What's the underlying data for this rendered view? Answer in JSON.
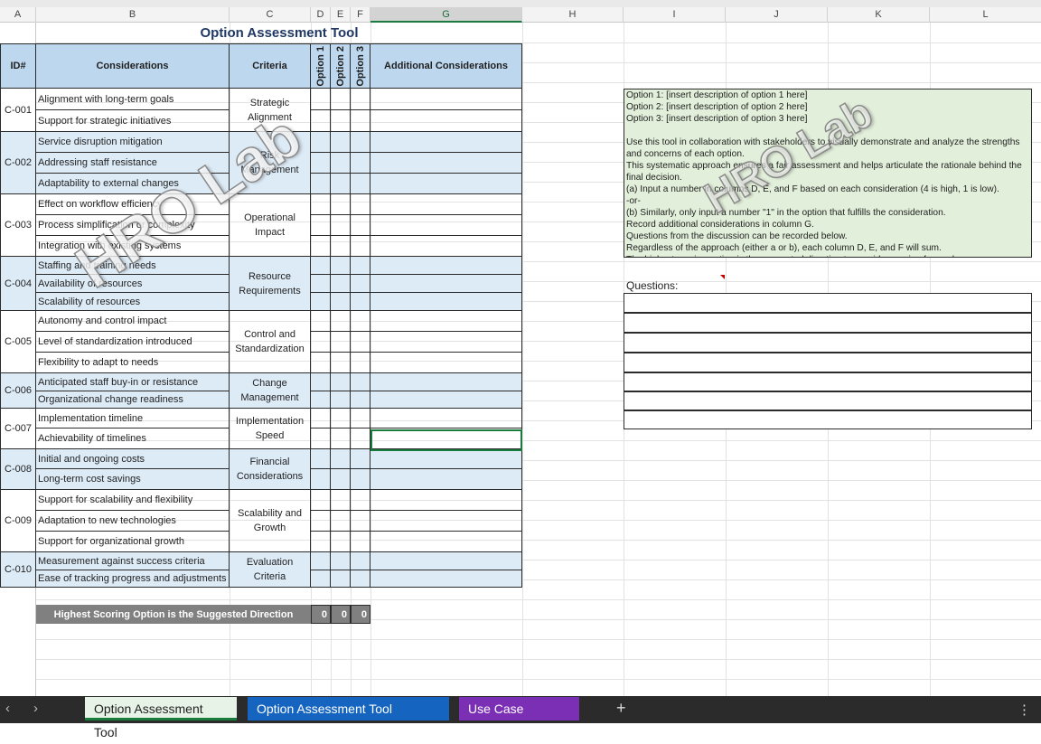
{
  "columns": [
    "A",
    "B",
    "C",
    "D",
    "E",
    "F",
    "G",
    "H",
    "I",
    "J",
    "K",
    "L"
  ],
  "title": "Option Assessment Tool",
  "table_header": {
    "id": "ID#",
    "considerations": "Considerations",
    "criteria": "Criteria",
    "option1": "Option 1",
    "option2": "Option 2",
    "option3": "Option 3",
    "additional": "Additional Considerations"
  },
  "groups": [
    {
      "id": "C-001",
      "criteria": "Strategic Alignment",
      "items": [
        "Alignment with long-term goals",
        "Support for strategic initiatives"
      ]
    },
    {
      "id": "C-002",
      "criteria": "Risk Management",
      "items": [
        "Service disruption mitigation",
        "Addressing staff resistance",
        "Adaptability to external changes"
      ]
    },
    {
      "id": "C-003",
      "criteria": "Operational Impact",
      "items": [
        "Effect on workflow efficiency",
        "Process simplification or complexity",
        "Integration with existing systems"
      ]
    },
    {
      "id": "C-004",
      "criteria": "Resource Requirements",
      "items": [
        "Staffing and training needs",
        "Availability of resources",
        "Scalability of resources"
      ]
    },
    {
      "id": "C-005",
      "criteria": "Control and Standardization",
      "items": [
        "Autonomy and control impact",
        "Level of standardization introduced",
        "Flexibility to adapt to needs"
      ]
    },
    {
      "id": "C-006",
      "criteria": "Change Management",
      "items": [
        "Anticipated staff buy-in or resistance",
        "Organizational change readiness"
      ]
    },
    {
      "id": "C-007",
      "criteria": "Implementation Speed",
      "items": [
        "Implementation timeline",
        "Achievability of timelines"
      ]
    },
    {
      "id": "C-008",
      "criteria": "Financial Considerations",
      "items": [
        "Initial and ongoing costs",
        "Long-term cost savings"
      ]
    },
    {
      "id": "C-009",
      "criteria": "Scalability and Growth",
      "items": [
        "Support for scalability and flexibility",
        "Adaptation to new technologies",
        "Support for organizational growth"
      ]
    },
    {
      "id": "C-010",
      "criteria": "Evaluation Criteria",
      "items": [
        "Measurement against success criteria",
        "Ease of tracking progress and adjustments"
      ]
    }
  ],
  "total": {
    "label": "Highest Scoring Option is the Suggested Direction",
    "values": [
      "0",
      "0",
      "0"
    ]
  },
  "note_lines": [
    "Option 1: [insert description of option 1 here]",
    "Option 2: [insert description of option 2 here]",
    "Option 3: [insert description of option 3 here]",
    "",
    "Use this tool in collaboration with stakeholders to visually demonstrate and analyze the strengths",
    "and concerns of each option.",
    "This systematic approach ensures a fair assessment and helps articulate the rationale behind the",
    "final decision.",
    "(a) Input a number in columns D, E, and F based on each consideration (4 is high, 1 is low).",
    "-or-",
    "(b) Similarly, only input a number \"1\" in the option that fulfills the consideration.",
    "Record additional considerations in column G.",
    "Questions from the discussion can be recorded below.",
    "Regardless of the approach (either a or b), each column D, E, and F will sum.",
    "The highest scoring option is the suggested direction to consider moving forward."
  ],
  "questions_label": "Questions:",
  "watermark": "HRO Lab",
  "tabs": [
    {
      "label": "Option Assessment Tool",
      "color": "#e8f3e8",
      "text": "#1f1f1f"
    },
    {
      "label": "Option Assessment Tool Example",
      "color": "#1565c0",
      "text": "#ffffff"
    },
    {
      "label": "Use Case Example",
      "color": "#7b2fb5",
      "text": "#ffffff"
    }
  ],
  "add_sheet": "+",
  "more_menu": "⋮"
}
